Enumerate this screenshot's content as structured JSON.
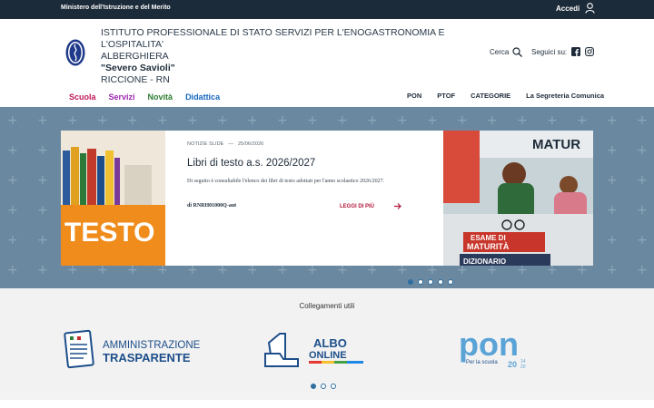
{
  "topbar": {
    "ministry": "Ministero dell'Istruzione e del Merito",
    "login_label": "Accedi"
  },
  "header": {
    "school_line1": "ISTITUTO PROFESSIONALE DI STATO SERVIZI PER L'ENOGASTRONOMIA E L'OSPITALITA'",
    "school_line2": "ALBERGHIERA",
    "school_name": "\"Severo Savioli\"",
    "school_place": "RICCIONE - RN",
    "search_label": "Cerca",
    "follow_label": "Seguici su:"
  },
  "mainnav": {
    "items": [
      {
        "label": "Scuola",
        "color": "#c2185b"
      },
      {
        "label": "Servizi",
        "color": "#9c27b0"
      },
      {
        "label": "Novità",
        "color": "#2e7d32"
      },
      {
        "label": "Didattica",
        "color": "#1565c0"
      }
    ]
  },
  "subnav": {
    "items": [
      "PON",
      "PTOF",
      "CATEGORIE",
      "La Segreteria Comunica"
    ]
  },
  "hero": {
    "meta_tag": "NOTIZIE SLIDE",
    "meta_sep": "—",
    "meta_date": "25/06/2026",
    "title": "Libri di testo a.s. 2026/2027",
    "description": "Di seguito è consultabile l'elenco dei libri di testo adottati per l'anno scolastico 2026/2027.",
    "author": "di RNRH01000Q-aut",
    "read_more": "LEGGI DI PIÙ",
    "left_image_text": "TESTO",
    "right_image_text_top": "MATUR",
    "right_image_book1": "ESAME DI",
    "right_image_book2": "MATURITÀ",
    "right_image_book3": "DIZIONARIO",
    "dots_active": 1,
    "dots_count": 5
  },
  "links": {
    "title": "Collegamenti utili",
    "amm_line1": "AMMINISTRAZIONE",
    "amm_line2": "TRASPARENTE",
    "albo_line1": "ALBO",
    "albo_line2": "ONLINE",
    "pon_main": "pon",
    "pon_sub": "Per la scuola",
    "pon_years": "20",
    "pon_years2": "14",
    "pon_years3": "20",
    "colors": {
      "accent_blue": "#2f6fa0",
      "pon_blue": "#5aa3d6"
    }
  }
}
